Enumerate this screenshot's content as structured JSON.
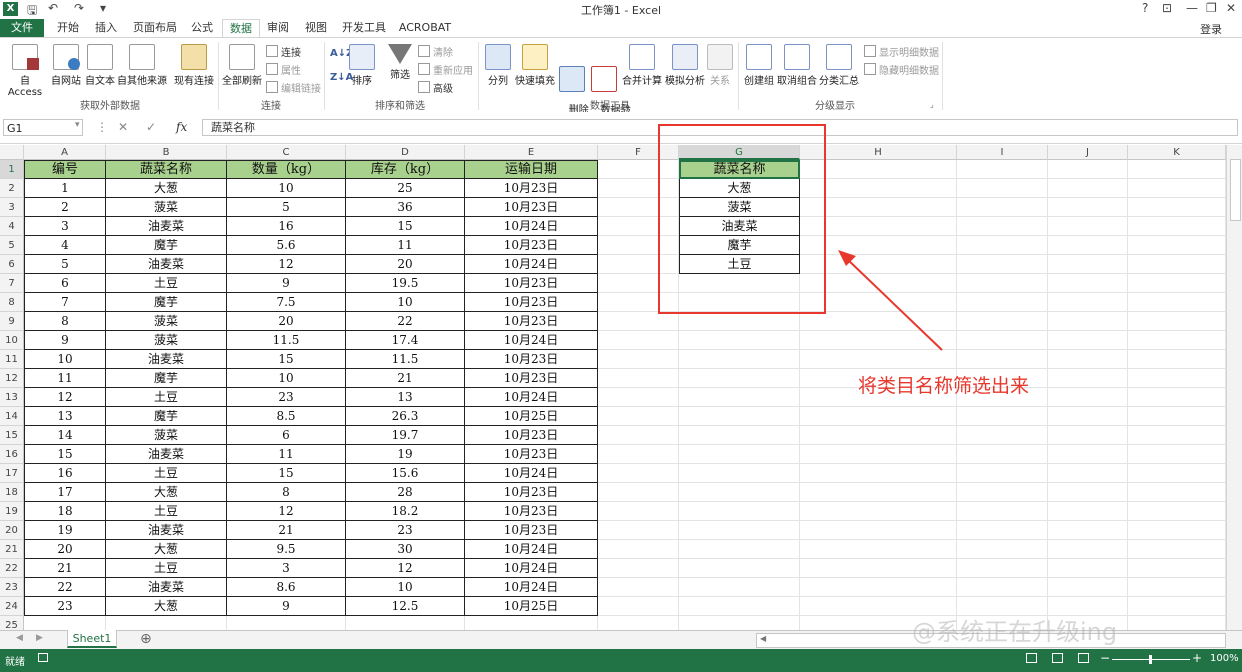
{
  "window": {
    "title": "工作簿1 - Excel",
    "app_badge": "X",
    "help": "?",
    "controls": [
      "⊡",
      "—",
      "❐",
      "✕"
    ]
  },
  "tabs": [
    {
      "label": "文件"
    },
    {
      "label": "开始"
    },
    {
      "label": "插入"
    },
    {
      "label": "页面布局"
    },
    {
      "label": "公式"
    },
    {
      "label": "数据"
    },
    {
      "label": "审阅"
    },
    {
      "label": "视图"
    },
    {
      "label": "开发工具"
    },
    {
      "label": "ACROBAT"
    }
  ],
  "login": "登录",
  "ribbon": {
    "get_external": {
      "buttons": [
        "自 Access",
        "自网站",
        "自文本",
        "自其他来源",
        "现有连接"
      ],
      "group": "获取外部数据"
    },
    "connections": {
      "refresh": "全部刷新",
      "small": [
        "连接",
        "属性",
        "编辑链接"
      ],
      "group": "连接"
    },
    "sort_filter": {
      "sort_az": "A↓Z",
      "sort_za": "Z↓A",
      "sort": "排序",
      "filter": "筛选",
      "small": [
        "清除",
        "重新应用",
        "高级"
      ],
      "group": "排序和筛选"
    },
    "data_tools": {
      "buttons": [
        "分列",
        "快速填充",
        "删除\n重复项",
        "数据验\n证",
        "合并计算",
        "模拟分析",
        "关系"
      ],
      "group": "数据工具"
    },
    "outline": {
      "buttons": [
        "创建组",
        "取消组合",
        "分类汇总"
      ],
      "small": [
        "显示明细数据",
        "隐藏明细数据"
      ],
      "group": "分级显示"
    }
  },
  "formula_bar": {
    "name_box": "G1",
    "formula": "蔬菜名称",
    "fx": "fx"
  },
  "columns": [
    "A",
    "B",
    "C",
    "D",
    "E",
    "F",
    "G",
    "H",
    "I",
    "J",
    "K"
  ],
  "rows": [
    "1",
    "2",
    "3",
    "4",
    "5",
    "6",
    "7",
    "8",
    "9",
    "10",
    "11",
    "12",
    "13",
    "14",
    "15",
    "16",
    "17",
    "18",
    "19",
    "20",
    "21",
    "22",
    "23",
    "24",
    "25"
  ],
  "table": {
    "headers": [
      "编号",
      "蔬菜名称",
      "数量（kg）",
      "库存（kg）",
      "运输日期"
    ],
    "rows": [
      [
        "1",
        "大葱",
        "10",
        "25",
        "10月23日"
      ],
      [
        "2",
        "菠菜",
        "5",
        "36",
        "10月23日"
      ],
      [
        "3",
        "油麦菜",
        "16",
        "15",
        "10月24日"
      ],
      [
        "4",
        "魔芋",
        "5.6",
        "11",
        "10月23日"
      ],
      [
        "5",
        "油麦菜",
        "12",
        "20",
        "10月24日"
      ],
      [
        "6",
        "土豆",
        "9",
        "19.5",
        "10月23日"
      ],
      [
        "7",
        "魔芋",
        "7.5",
        "10",
        "10月23日"
      ],
      [
        "8",
        "菠菜",
        "20",
        "22",
        "10月23日"
      ],
      [
        "9",
        "菠菜",
        "11.5",
        "17.4",
        "10月24日"
      ],
      [
        "10",
        "油麦菜",
        "15",
        "11.5",
        "10月23日"
      ],
      [
        "11",
        "魔芋",
        "10",
        "21",
        "10月23日"
      ],
      [
        "12",
        "土豆",
        "23",
        "13",
        "10月24日"
      ],
      [
        "13",
        "魔芋",
        "8.5",
        "26.3",
        "10月25日"
      ],
      [
        "14",
        "菠菜",
        "6",
        "19.7",
        "10月23日"
      ],
      [
        "15",
        "油麦菜",
        "11",
        "19",
        "10月23日"
      ],
      [
        "16",
        "土豆",
        "15",
        "15.6",
        "10月24日"
      ],
      [
        "17",
        "大葱",
        "8",
        "28",
        "10月23日"
      ],
      [
        "18",
        "土豆",
        "12",
        "18.2",
        "10月23日"
      ],
      [
        "19",
        "油麦菜",
        "21",
        "23",
        "10月23日"
      ],
      [
        "20",
        "大葱",
        "9.5",
        "30",
        "10月24日"
      ],
      [
        "21",
        "土豆",
        "3",
        "12",
        "10月24日"
      ],
      [
        "22",
        "油麦菜",
        "8.6",
        "10",
        "10月24日"
      ],
      [
        "23",
        "大葱",
        "9",
        "12.5",
        "10月25日"
      ]
    ]
  },
  "filtered": {
    "header": "蔬菜名称",
    "items": [
      "大葱",
      "菠菜",
      "油麦菜",
      "魔芋",
      "土豆"
    ]
  },
  "annotation": "将类目名称筛选出来",
  "sheet_tab": "Sheet1",
  "add_sheet": "⊕",
  "status": {
    "ready": "就绪",
    "zoom": "100%"
  },
  "watermark": "@系统正在升级ing",
  "colors": {
    "excel_green": "#217346",
    "header_fill": "#a9d18e",
    "annotation_red": "#e8382e"
  }
}
